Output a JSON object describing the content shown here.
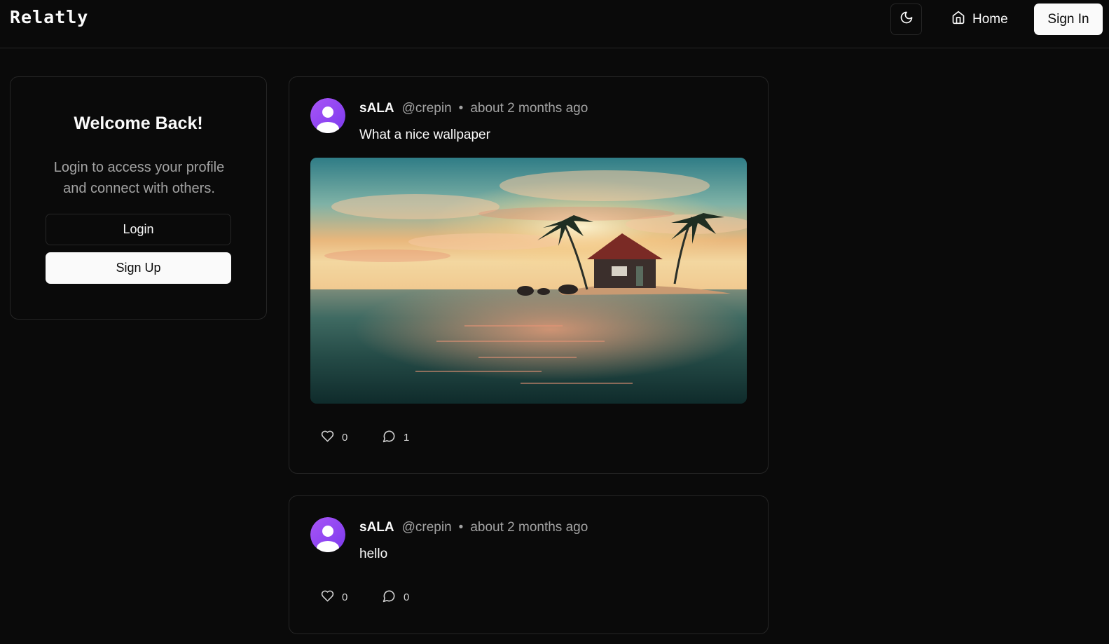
{
  "app": {
    "logo": "Relatly"
  },
  "nav": {
    "home_label": "Home",
    "signin_label": "Sign In",
    "theme_icon": "moon-icon",
    "home_icon": "home-icon"
  },
  "welcome": {
    "title": "Welcome Back!",
    "description": "Login to access your profile and connect with others.",
    "login_label": "Login",
    "signup_label": "Sign Up"
  },
  "posts": [
    {
      "author": "sALA",
      "handle": "@crepin",
      "separator": "•",
      "time": "about 2 months ago",
      "content": "What a nice wallpaper",
      "has_image": true,
      "likes": "0",
      "comments": "1"
    },
    {
      "author": "sALA",
      "handle": "@crepin",
      "separator": "•",
      "time": "about 2 months ago",
      "content": "hello",
      "has_image": false,
      "likes": "0",
      "comments": "0"
    }
  ],
  "colors": {
    "background": "#0a0a0a",
    "border": "#262626",
    "text": "#fafafa",
    "muted": "#a3a3a3",
    "avatar_accent": "#9333ea"
  }
}
